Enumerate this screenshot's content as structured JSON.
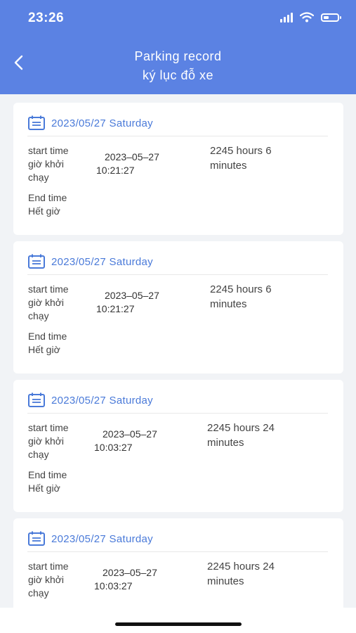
{
  "status": {
    "time": "23:26"
  },
  "header": {
    "title_en": "Parking record",
    "title_vi": "ký lục đỗ xe"
  },
  "labels": {
    "start_en": "start time",
    "start_vi_1": "giờ khởi",
    "start_vi_2": "chạy",
    "end_en": "End time",
    "end_vi": "Hết giờ"
  },
  "records": [
    {
      "date": "2023/05/27 Saturday",
      "start_date": "2023–05–27",
      "start_clock": "10:21:27",
      "duration_1": "2245 hours 6",
      "duration_2": "minutes"
    },
    {
      "date": "2023/05/27 Saturday",
      "start_date": "2023–05–27",
      "start_clock": "10:21:27",
      "duration_1": "2245 hours 6",
      "duration_2": "minutes"
    },
    {
      "date": "2023/05/27 Saturday",
      "start_date": "2023–05–27",
      "start_clock": "10:03:27",
      "duration_1": "2245 hours 24",
      "duration_2": "minutes"
    },
    {
      "date": "2023/05/27 Saturday",
      "start_date": "2023–05–27",
      "start_clock": "10:03:27",
      "duration_1": "2245 hours 24",
      "duration_2": "minutes"
    }
  ],
  "colors": {
    "header": "#5b82e3",
    "accent": "#4a7ad9",
    "background": "#f1f3f6"
  }
}
